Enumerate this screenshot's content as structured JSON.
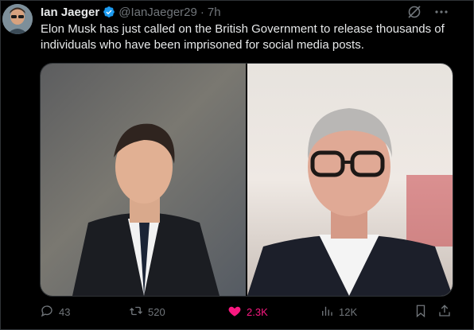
{
  "tweet": {
    "author_name": "Ian Jaeger",
    "handle": "@IanJaeger29",
    "separator": "·",
    "time": "7h",
    "text": "Elon Musk has just called on the British Government to release thousands of individuals who have been imprisoned for social media posts.",
    "verified": true
  },
  "actions": {
    "replies": "43",
    "reposts": "520",
    "likes": "2.3K",
    "views": "12K",
    "liked": true
  },
  "icons": {
    "avatar": "avatar-photo",
    "verified": "verified-badge-icon",
    "grok": "grok-icon",
    "more": "more-icon",
    "reply": "reply-icon",
    "repost": "repost-icon",
    "like": "heart-icon",
    "views": "views-icon",
    "bookmark": "bookmark-icon",
    "share": "share-icon"
  },
  "colors": {
    "background": "#000000",
    "text": "#e7e9ea",
    "muted": "#71767b",
    "verified": "#1d9bf0",
    "like": "#f91880",
    "border": "#2f3336"
  }
}
